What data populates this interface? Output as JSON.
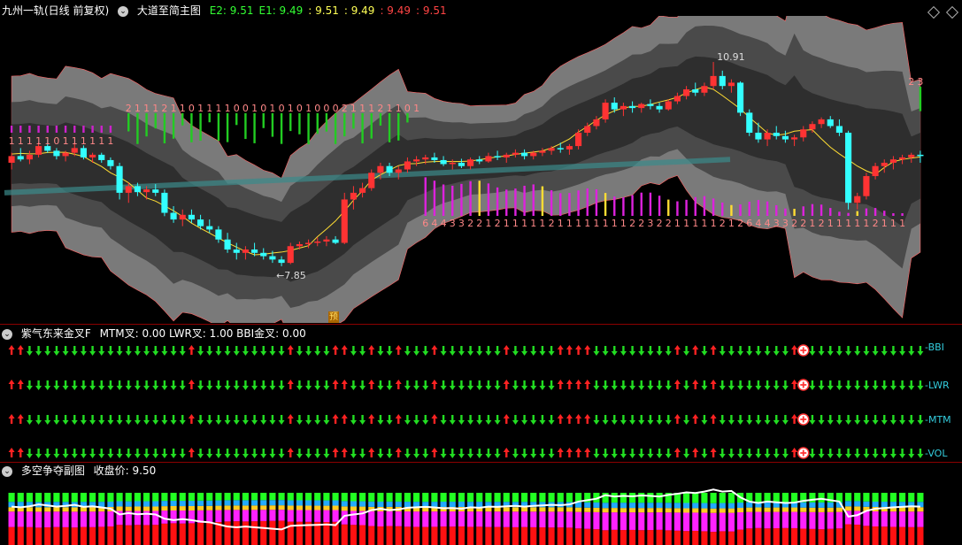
{
  "main": {
    "stock": "九州一轨(日线 前复权)",
    "indicator": "大道至简主图",
    "legend": [
      {
        "label": "E2:",
        "value": "9.51",
        "color": "#33ff33"
      },
      {
        "label": "E1:",
        "value": "9.49",
        "color": "#33ff33"
      },
      {
        "label": ":",
        "value": "9.51",
        "color": "#ffff55"
      },
      {
        "label": ":",
        "value": "9.49",
        "color": "#ffff55"
      },
      {
        "label": ":",
        "value": "9.49",
        "color": "#ff4444"
      },
      {
        "label": ":",
        "value": "9.51",
        "color": "#ff4444"
      }
    ],
    "low_label": "←7.85",
    "high_label": "10.91",
    "forecast_badge": "预"
  },
  "panel2": {
    "title": "紫气东来金叉F",
    "values": "MTM叉: 0.00  LWR叉: 1.00  BBI金叉: 0.00",
    "rows": [
      {
        "label": "BBI"
      },
      {
        "label": "LWR"
      },
      {
        "label": "MTM"
      },
      {
        "label": "VOL"
      }
    ]
  },
  "panel3": {
    "title": "多空争夺副图",
    "values": "收盘价: 9.50"
  },
  "colors": {
    "up": "#ff3333",
    "down": "#33ffff",
    "arrow_up": "#ff2222",
    "arrow_down": "#22dd22"
  },
  "chart_data": {
    "type": "candlestick",
    "ohlc": [
      [
        9.4,
        9.55,
        9.3,
        9.5
      ],
      [
        9.5,
        9.62,
        9.42,
        9.45
      ],
      [
        9.45,
        9.58,
        9.38,
        9.52
      ],
      [
        9.52,
        9.7,
        9.48,
        9.65
      ],
      [
        9.65,
        9.75,
        9.55,
        9.58
      ],
      [
        9.58,
        9.62,
        9.45,
        9.5
      ],
      [
        9.5,
        9.58,
        9.42,
        9.55
      ],
      [
        9.55,
        9.7,
        9.5,
        9.62
      ],
      [
        9.62,
        9.66,
        9.45,
        9.48
      ],
      [
        9.48,
        9.55,
        9.4,
        9.52
      ],
      [
        9.52,
        9.55,
        9.4,
        9.44
      ],
      [
        9.44,
        9.48,
        9.3,
        9.35
      ],
      [
        9.35,
        9.4,
        8.85,
        8.95
      ],
      [
        8.95,
        9.1,
        8.8,
        9.05
      ],
      [
        9.05,
        9.1,
        8.9,
        8.96
      ],
      [
        8.96,
        9.05,
        8.85,
        9.0
      ],
      [
        9.0,
        9.08,
        8.9,
        8.95
      ],
      [
        8.95,
        9.0,
        8.6,
        8.65
      ],
      [
        8.65,
        8.75,
        8.5,
        8.55
      ],
      [
        8.55,
        8.7,
        8.45,
        8.62
      ],
      [
        8.62,
        8.7,
        8.5,
        8.55
      ],
      [
        8.55,
        8.62,
        8.4,
        8.45
      ],
      [
        8.45,
        8.55,
        8.35,
        8.4
      ],
      [
        8.4,
        8.45,
        8.2,
        8.25
      ],
      [
        8.25,
        8.35,
        8.05,
        8.1
      ],
      [
        8.1,
        8.2,
        7.95,
        8.05
      ],
      [
        8.05,
        8.15,
        7.95,
        8.1
      ],
      [
        8.1,
        8.2,
        8.0,
        8.05
      ],
      [
        8.05,
        8.12,
        7.95,
        8.0
      ],
      [
        8.0,
        8.08,
        7.9,
        7.95
      ],
      [
        7.95,
        8.0,
        7.85,
        7.9
      ],
      [
        7.9,
        8.2,
        7.88,
        8.15
      ],
      [
        8.15,
        8.22,
        8.1,
        8.18
      ],
      [
        8.18,
        8.25,
        8.12,
        8.2
      ],
      [
        8.2,
        8.28,
        8.15,
        8.22
      ],
      [
        8.22,
        8.3,
        8.15,
        8.25
      ],
      [
        8.25,
        8.3,
        8.18,
        8.2
      ],
      [
        8.2,
        8.95,
        8.18,
        8.85
      ],
      [
        8.85,
        9.05,
        8.7,
        8.95
      ],
      [
        8.95,
        9.1,
        8.88,
        9.02
      ],
      [
        9.02,
        9.3,
        8.98,
        9.25
      ],
      [
        9.25,
        9.4,
        9.15,
        9.35
      ],
      [
        9.35,
        9.4,
        9.2,
        9.25
      ],
      [
        9.25,
        9.35,
        9.15,
        9.3
      ],
      [
        9.3,
        9.48,
        9.25,
        9.42
      ],
      [
        9.42,
        9.5,
        9.35,
        9.45
      ],
      [
        9.45,
        9.52,
        9.38,
        9.48
      ],
      [
        9.48,
        9.55,
        9.4,
        9.44
      ],
      [
        9.44,
        9.5,
        9.35,
        9.38
      ],
      [
        9.38,
        9.45,
        9.3,
        9.4
      ],
      [
        9.4,
        9.46,
        9.32,
        9.35
      ],
      [
        9.35,
        9.48,
        9.3,
        9.45
      ],
      [
        9.45,
        9.5,
        9.38,
        9.42
      ],
      [
        9.42,
        9.55,
        9.4,
        9.5
      ],
      [
        9.5,
        9.58,
        9.44,
        9.48
      ],
      [
        9.48,
        9.55,
        9.4,
        9.52
      ],
      [
        9.52,
        9.6,
        9.48,
        9.55
      ],
      [
        9.55,
        9.6,
        9.45,
        9.5
      ],
      [
        9.5,
        9.58,
        9.45,
        9.55
      ],
      [
        9.55,
        9.62,
        9.5,
        9.58
      ],
      [
        9.58,
        9.65,
        9.52,
        9.62
      ],
      [
        9.62,
        9.7,
        9.55,
        9.6
      ],
      [
        9.6,
        9.68,
        9.52,
        9.65
      ],
      [
        9.65,
        9.9,
        9.6,
        9.85
      ],
      [
        9.85,
        10.0,
        9.8,
        9.95
      ],
      [
        9.95,
        10.1,
        9.9,
        10.05
      ],
      [
        10.05,
        10.35,
        10.0,
        10.3
      ],
      [
        10.3,
        10.38,
        10.15,
        10.2
      ],
      [
        10.2,
        10.3,
        10.1,
        10.25
      ],
      [
        10.25,
        10.32,
        10.15,
        10.22
      ],
      [
        10.22,
        10.3,
        10.15,
        10.28
      ],
      [
        10.28,
        10.35,
        10.2,
        10.25
      ],
      [
        10.25,
        10.3,
        10.15,
        10.2
      ],
      [
        10.2,
        10.35,
        10.18,
        10.32
      ],
      [
        10.32,
        10.45,
        10.28,
        10.4
      ],
      [
        10.4,
        10.55,
        10.35,
        10.5
      ],
      [
        10.5,
        10.6,
        10.4,
        10.45
      ],
      [
        10.45,
        10.6,
        10.4,
        10.55
      ],
      [
        10.55,
        10.91,
        10.5,
        10.7
      ],
      [
        10.7,
        10.78,
        10.5,
        10.55
      ],
      [
        10.55,
        10.65,
        10.45,
        10.6
      ],
      [
        10.6,
        10.62,
        10.1,
        10.15
      ],
      [
        10.15,
        10.2,
        9.8,
        9.85
      ],
      [
        9.85,
        10.0,
        9.7,
        9.75
      ],
      [
        9.75,
        9.9,
        9.65,
        9.85
      ],
      [
        9.85,
        9.95,
        9.75,
        9.8
      ],
      [
        9.8,
        9.88,
        9.7,
        9.75
      ],
      [
        9.75,
        9.82,
        9.65,
        9.78
      ],
      [
        9.78,
        9.95,
        9.72,
        9.9
      ],
      [
        9.9,
        10.02,
        9.85,
        9.98
      ],
      [
        9.98,
        10.08,
        9.92,
        10.05
      ],
      [
        10.05,
        10.1,
        9.92,
        9.95
      ],
      [
        9.95,
        10.05,
        9.8,
        9.85
      ],
      [
        9.85,
        9.88,
        8.7,
        8.8
      ],
      [
        8.8,
        8.95,
        8.7,
        8.9
      ],
      [
        8.9,
        9.25,
        8.85,
        9.2
      ],
      [
        9.2,
        9.4,
        9.15,
        9.35
      ],
      [
        9.35,
        9.45,
        9.25,
        9.4
      ],
      [
        9.4,
        9.5,
        9.3,
        9.45
      ],
      [
        9.45,
        9.52,
        9.38,
        9.48
      ],
      [
        9.48,
        9.55,
        9.4,
        9.52
      ],
      [
        9.52,
        9.58,
        9.4,
        9.5
      ]
    ],
    "panel3_close_scale": [
      7.8,
      10.9
    ]
  }
}
